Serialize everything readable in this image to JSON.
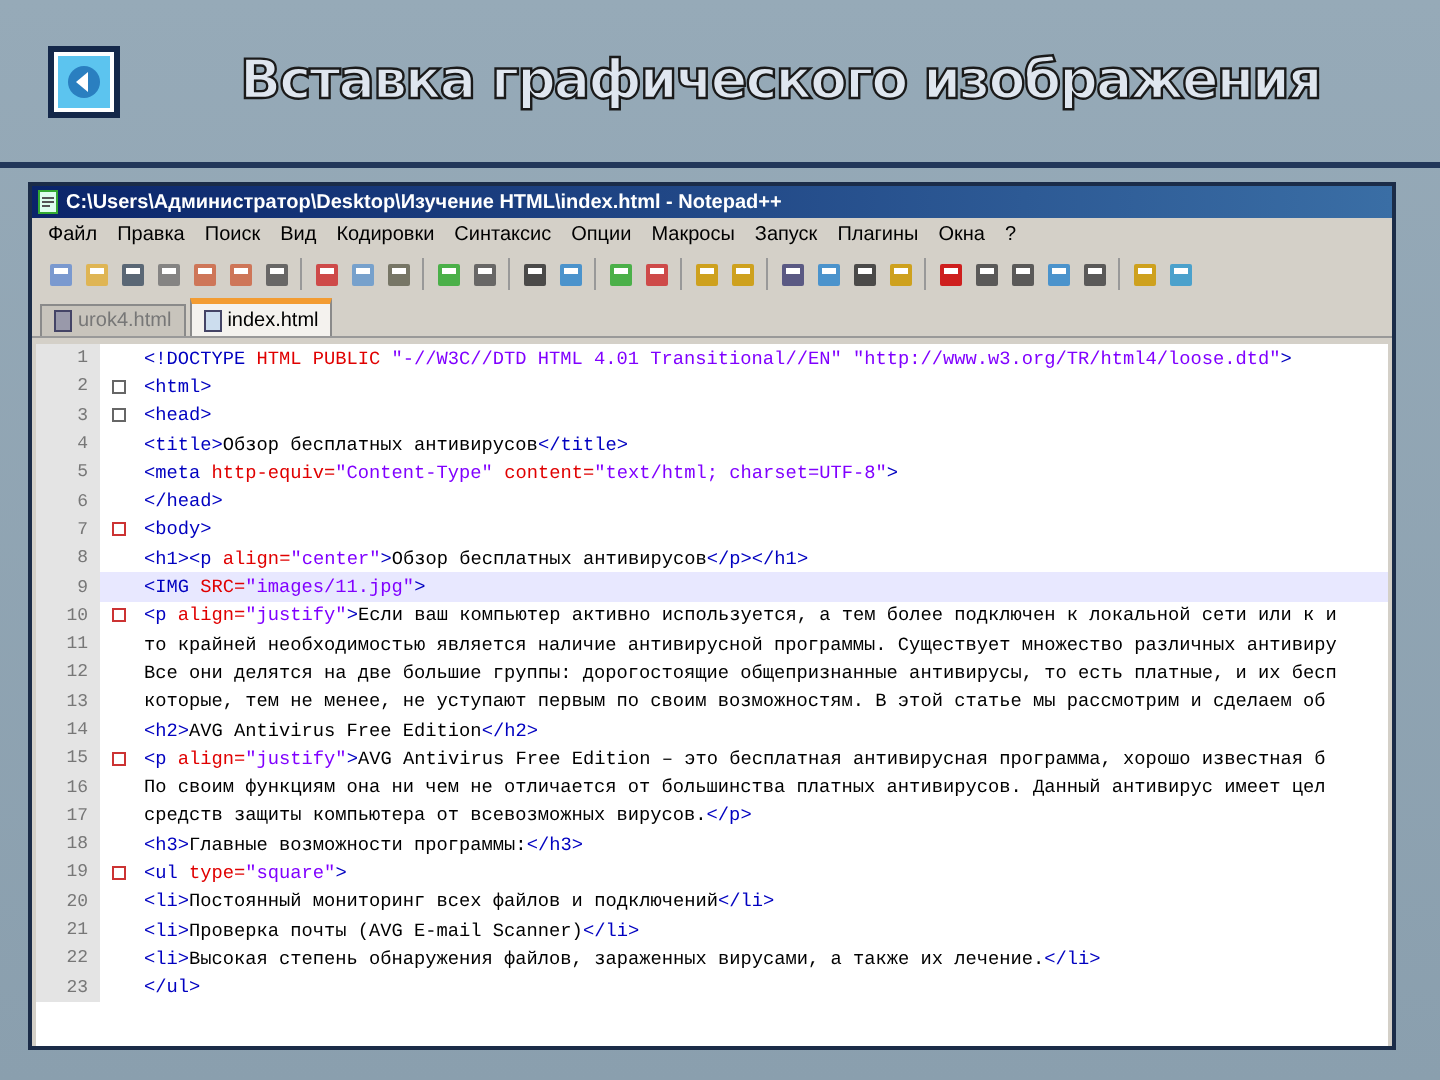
{
  "slide": {
    "title": "Вставка графического изображения"
  },
  "window": {
    "title": "C:\\Users\\Администратор\\Desktop\\Изучение HTML\\index.html - Notepad++"
  },
  "menu": [
    "Файл",
    "Правка",
    "Поиск",
    "Вид",
    "Кодировки",
    "Синтаксис",
    "Опции",
    "Макросы",
    "Запуск",
    "Плагины",
    "Окна",
    "?"
  ],
  "tabs": [
    {
      "label": "urok4.html",
      "selected": false
    },
    {
      "label": "index.html",
      "selected": true
    }
  ],
  "editor": {
    "lines": [
      {
        "number": "1",
        "text": "<!DOCTYPE HTML PUBLIC \"-//W3C//DTD HTML 4.01 Transitional//EN\" \"http://www.w3.org/TR/html4/loose.dtd\">",
        "fold": false,
        "selected": false
      },
      {
        "number": "2",
        "text": "<html>",
        "fold": true,
        "selected": false
      },
      {
        "number": "3",
        "text": "<head>",
        "fold": true,
        "selected": false
      },
      {
        "number": "4",
        "text": "<title>Обзор бесплатных антивирусов</title>",
        "fold": false,
        "selected": false
      },
      {
        "number": "5",
        "text": "<meta http-equiv=\"Content-Type\" content=\"text/html; charset=UTF-8\">",
        "fold": false,
        "selected": false
      },
      {
        "number": "6",
        "text": "</head>",
        "fold": false,
        "selected": false
      },
      {
        "number": "7",
        "text": "<body>",
        "fold": true,
        "selected": false
      },
      {
        "number": "8",
        "text": "<h1><p align=\"center\">Обзор бесплатных антивирусов</p></h1>",
        "fold": false,
        "selected": false
      },
      {
        "number": "9",
        "text": "<IMG SRC=\"images/11.jpg\">",
        "fold": false,
        "selected": true
      },
      {
        "number": "10",
        "text": "<p align=\"justify\">Если ваш компьютер активно используется, а тем более подключен к локальной сети или к и",
        "fold": true,
        "selected": false
      },
      {
        "number": "11",
        "text": "то крайней необходимостью является наличие антивирусной программы. Существует множество различных антивиру",
        "fold": false,
        "selected": false
      },
      {
        "number": "12",
        "text": "Все они делятся на две большие группы: дорогостоящие общепризнанные антивирусы, то есть платные, и их бесп",
        "fold": false,
        "selected": false
      },
      {
        "number": "13",
        "text": "которые, тем не менее, не уступают первым по своим возможностям. В этой статье мы рассмотрим и сделаем об",
        "fold": false,
        "selected": false
      },
      {
        "number": "14",
        "text": "<h2>AVG Antivirus Free Edition</h2>",
        "fold": false,
        "selected": false
      },
      {
        "number": "15",
        "text": "<p align=\"justify\">AVG Antivirus Free Edition – это бесплатная антивирусная программа, хорошо известная б",
        "fold": true,
        "selected": false
      },
      {
        "number": "16",
        "text": "По своим функциям она ни чем не отличается от большинства платных антивирусов. Данный антивирус имеет цел",
        "fold": false,
        "selected": false
      },
      {
        "number": "17",
        "text": "средств защиты компьютера от всевозможных вирусов.</p>",
        "fold": false,
        "selected": false
      },
      {
        "number": "18",
        "text": "<h3>Главные возможности программы:</h3>",
        "fold": false,
        "selected": false
      },
      {
        "number": "19",
        "text": "<ul type=\"square\">",
        "fold": true,
        "selected": false
      },
      {
        "number": "20",
        "text": "<li>Постоянный мониторинг всех файлов и подключений</li>",
        "fold": false,
        "selected": false
      },
      {
        "number": "21",
        "text": "<li>Проверка почты (AVG E-mail Scanner)</li>",
        "fold": false,
        "selected": false
      },
      {
        "number": "22",
        "text": "<li>Высокая степень обнаружения файлов, зараженных вирусами, а также их лечение.</li>",
        "fold": false,
        "selected": false
      },
      {
        "number": "23",
        "text": "</ul>",
        "fold": false,
        "selected": false
      }
    ]
  }
}
